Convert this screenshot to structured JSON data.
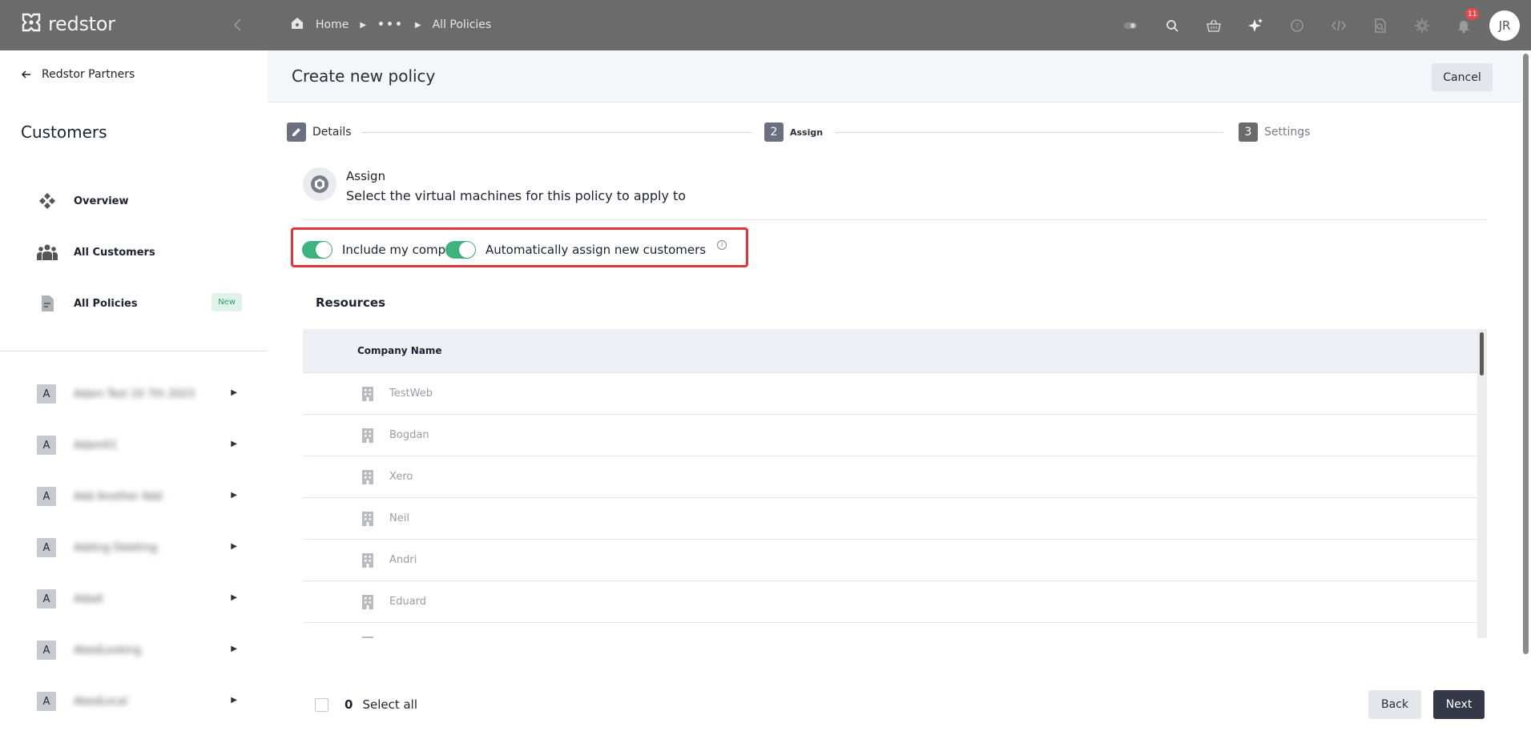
{
  "brand": {
    "name": "redstor",
    "logo_icon": "redstor-logo-icon"
  },
  "breadcrumb": {
    "home": "Home",
    "ellipsis": "•••",
    "current": "All Policies"
  },
  "topbar": {
    "icons": [
      "toggle-icon",
      "search-icon",
      "basket-icon",
      "sparkle-icon",
      "help-icon",
      "code-icon",
      "doc-search-icon",
      "gear-icon",
      "bell-icon"
    ],
    "notification_count": "11",
    "avatar_initials": "JR"
  },
  "sidebar": {
    "back_label": "Redstor Partners",
    "title": "Customers",
    "nav": [
      {
        "label": "Overview",
        "icon": "overview-icon"
      },
      {
        "label": "All Customers",
        "icon": "users-icon"
      },
      {
        "label": "All Policies",
        "icon": "document-icon",
        "badge": "New"
      }
    ],
    "customers": [
      {
        "initial": "A",
        "name": "Adam Test 10 7th 2023"
      },
      {
        "initial": "A",
        "name": "Adam01"
      },
      {
        "initial": "A",
        "name": "Add Another Add"
      },
      {
        "initial": "A",
        "name": "Adding Deleting"
      },
      {
        "initial": "A",
        "name": "Adadi"
      },
      {
        "initial": "A",
        "name": "AbedLooking"
      },
      {
        "initial": "A",
        "name": "AbedLocal"
      }
    ]
  },
  "main": {
    "title": "Create new policy",
    "cancel_label": "Cancel",
    "steps": [
      {
        "number": "",
        "label": "Details",
        "state": "done"
      },
      {
        "number": "2",
        "label": "Assign",
        "state": "active"
      },
      {
        "number": "3",
        "label": "Settings",
        "state": "pending"
      }
    ],
    "assign": {
      "title": "Assign",
      "subtitle": "Select the virtual machines for this policy to apply to"
    },
    "toggles": {
      "include_company": "Include my company",
      "auto_assign": "Automatically assign new customers",
      "include_company_on": true,
      "auto_assign_on": true
    },
    "resources": {
      "title": "Resources",
      "column": "Company Name",
      "rows": [
        "TestWeb",
        "Bogdan",
        "Xero",
        "Neil",
        "Andri",
        "Eduard"
      ]
    },
    "footer": {
      "selected_count": "0",
      "select_all_label": "Select all",
      "back_label": "Back",
      "next_label": "Next"
    }
  },
  "colors": {
    "topbar": "#6b6b6b",
    "accent_green": "#3fb37f",
    "highlight_red": "#e0353a",
    "primary_dark": "#343849"
  }
}
